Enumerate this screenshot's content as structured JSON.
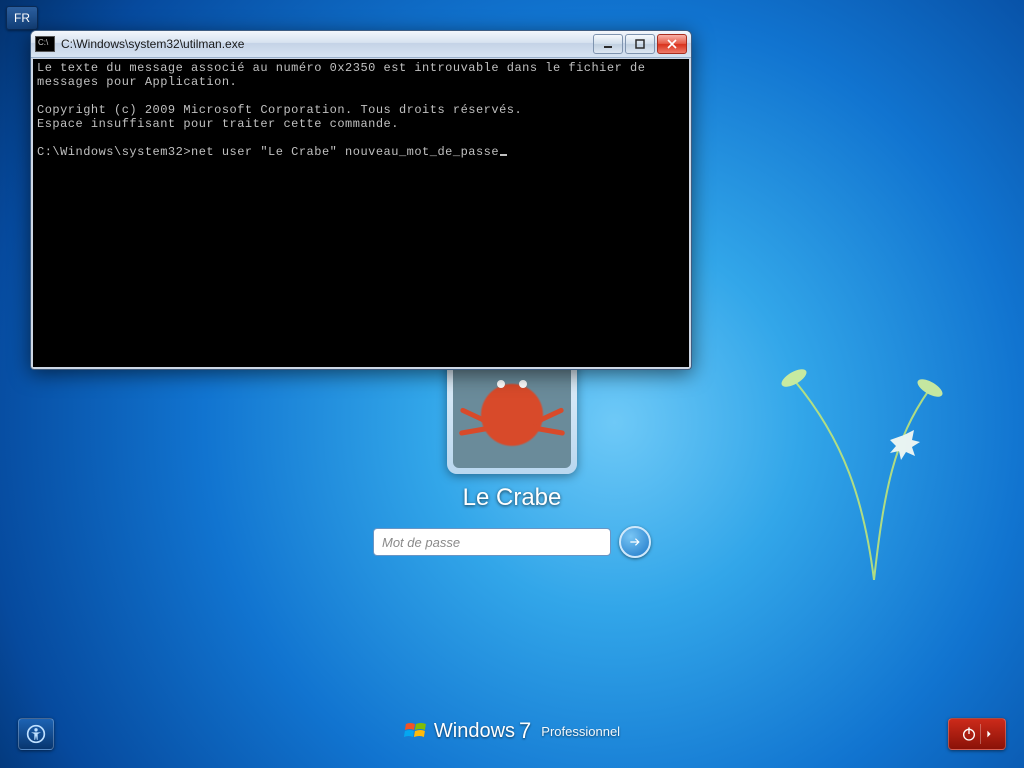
{
  "lang_indicator": "FR",
  "login": {
    "username": "Le Crabe",
    "password_placeholder": "Mot de passe"
  },
  "branding": {
    "product": "Windows",
    "version": "7",
    "edition": "Professionnel"
  },
  "cmd": {
    "title": "C:\\Windows\\system32\\utilman.exe",
    "lines": [
      "Le texte du message associé au numéro 0x2350 est introuvable dans le fichier de",
      "messages pour Application.",
      "",
      "Copyright (c) 2009 Microsoft Corporation. Tous droits réservés.",
      "Espace insuffisant pour traiter cette commande.",
      "",
      "C:\\Windows\\system32>net user \"Le Crabe\" nouveau_mot_de_passe"
    ]
  }
}
